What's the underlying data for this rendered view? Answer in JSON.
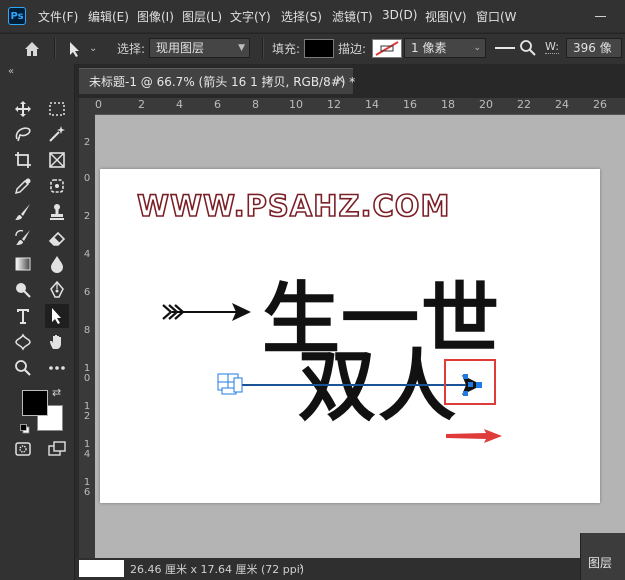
{
  "app": {
    "logo_text": "Ps"
  },
  "menu": [
    "文件(F)",
    "编辑(E)",
    "图像(I)",
    "图层(L)",
    "文字(Y)",
    "选择(S)",
    "滤镜(T)",
    "3D(D)",
    "视图(V)",
    "窗口(W"
  ],
  "options": {
    "select_label": "选择:",
    "select_value": "现用图层",
    "fill_label": "填充:",
    "fill_color": "#000000",
    "stroke_label": "描边:",
    "stroke_width": "1 像素",
    "w_label": "W:",
    "w_value": "396 像"
  },
  "document": {
    "tab_title": "未标题-1 @ 66.7% (箭头 16 1 拷贝, RGB/8#) *",
    "close_glyph": "×"
  },
  "ruler": {
    "top_labels": [
      "0",
      "2",
      "4",
      "6",
      "8",
      "10",
      "12",
      "14",
      "16",
      "18",
      "20",
      "22",
      "24",
      "26"
    ],
    "left_labels": [
      "2",
      "0",
      "2",
      "4",
      "6",
      "8",
      "1\n0",
      "1\n2",
      "1\n4",
      "1\n6"
    ]
  },
  "canvas": {
    "watermark": "WWW.PSAHZ.COM",
    "line1_chars": [
      "生",
      "一",
      "世"
    ],
    "line2_chars": [
      "双",
      "人"
    ],
    "watermark_stroke": "#7a1f26",
    "accent_blue": "#1f7be6",
    "accent_red": "#e03b3b"
  },
  "status": {
    "doc_size": "26.46 厘米 x 17.64 厘米 (72 ppi)",
    "arrow": "›"
  },
  "panels": {
    "layers_tab": "图层"
  },
  "tools": [
    "move-tool",
    "marquee-tool",
    "lasso-tool",
    "magic-wand-tool",
    "crop-tool",
    "frame-tool",
    "eyedropper-tool",
    "patch-tool",
    "brush-tool",
    "stamp-tool",
    "history-brush-tool",
    "eraser-tool",
    "gradient-tool",
    "blur-tool",
    "dodge-tool",
    "pen-tool",
    "type-tool",
    "path-selection-tool",
    "custom-shape-tool",
    "hand-tool",
    "zoom-tool",
    "more-tools"
  ],
  "colors": {
    "foreground": "#000000",
    "background": "#ffffff"
  }
}
